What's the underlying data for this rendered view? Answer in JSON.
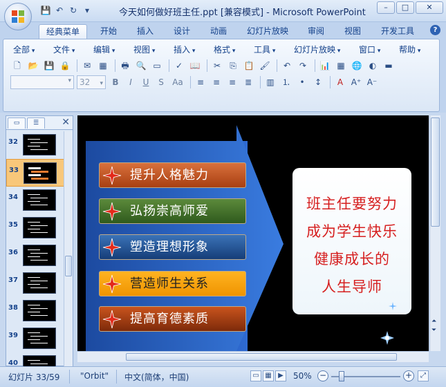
{
  "window": {
    "title": "今天如何做好班主任.ppt [兼容模式] - Microsoft PowerPoint",
    "controls": [
      "–",
      "□",
      "✕"
    ]
  },
  "ribbon_tabs": [
    "经典菜单",
    "开始",
    "插入",
    "设计",
    "动画",
    "幻灯片放映",
    "审阅",
    "视图",
    "开发工具"
  ],
  "help_label": "?",
  "menus": [
    "全部",
    "文件",
    "编辑",
    "视图",
    "插入",
    "格式",
    "工具",
    "幻灯片放映",
    "窗口",
    "帮助"
  ],
  "font": {
    "name": "",
    "size": "32"
  },
  "format_buttons": [
    "B",
    "I",
    "U",
    "S",
    "Aa"
  ],
  "panel": {
    "selected_slide": "33"
  },
  "slide_numbers": [
    "32",
    "33",
    "34",
    "35",
    "36",
    "37",
    "38",
    "39",
    "40"
  ],
  "slide": {
    "items": [
      "提升人格魅力",
      "弘扬崇高师爱",
      "塑造理想形象",
      "营造师生关系",
      "提高育德素质"
    ],
    "callout_lines": [
      "班主任要努力",
      "成为学生快乐",
      "健康成长的",
      "人生导师"
    ]
  },
  "status": {
    "slide_info": "幻灯片 33/59",
    "theme": "\"Orbit\"",
    "language": "中文(简体，中国)",
    "zoom": "50%",
    "zoom_fraction": 0.5
  },
  "colors": {
    "item_orange": "#c9541d",
    "item_green": "#3c6b2a",
    "item_blue": "#1a4f8e",
    "item_gold": "#f7a10a",
    "callout_text": "#d62020"
  }
}
